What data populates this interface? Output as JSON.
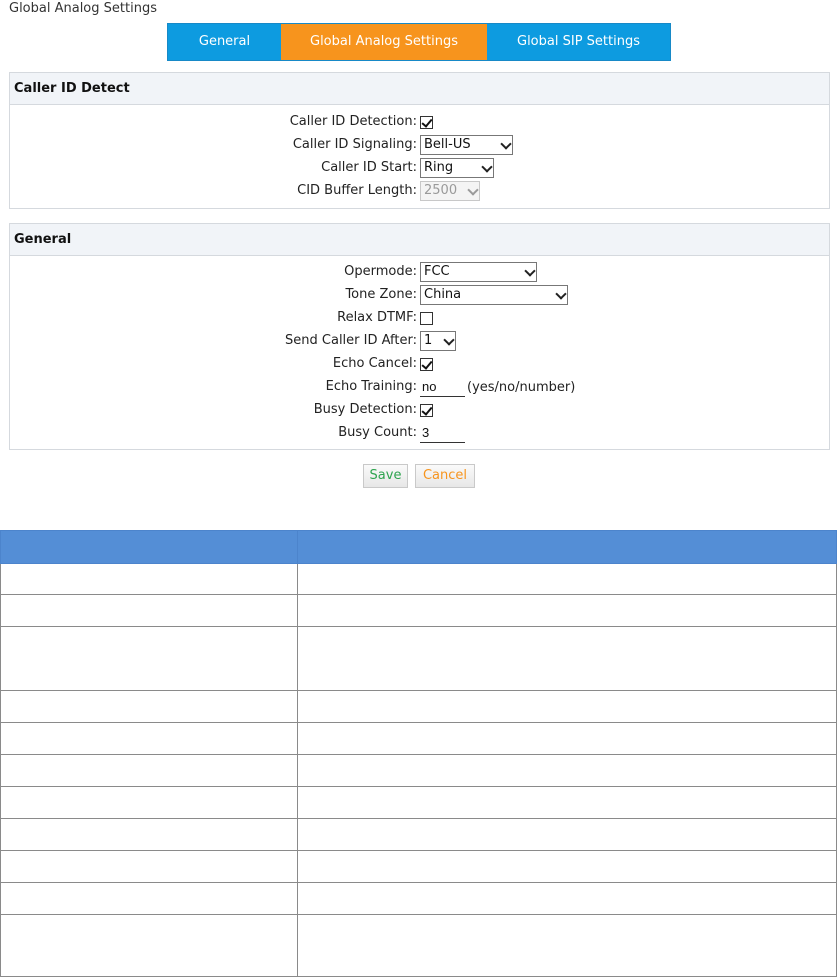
{
  "page_title": "Global Analog Settings",
  "tabs": [
    {
      "label": "General"
    },
    {
      "label": "Global Analog Settings"
    },
    {
      "label": "Global SIP Settings"
    }
  ],
  "caller_id_detect": {
    "title": "Caller ID Detect",
    "caller_id_detection": {
      "label": "Caller ID Detection:",
      "checked": true
    },
    "caller_id_signaling": {
      "label": "Caller ID Signaling:",
      "value": "Bell-US"
    },
    "caller_id_start": {
      "label": "Caller ID Start:",
      "value": "Ring"
    },
    "cid_buffer_length": {
      "label": "CID Buffer Length:",
      "value": "2500",
      "disabled": true
    }
  },
  "general": {
    "title": "General",
    "opermode": {
      "label": "Opermode:",
      "value": "FCC"
    },
    "tone_zone": {
      "label": "Tone Zone:",
      "value": "China"
    },
    "relax_dtmf": {
      "label": "Relax DTMF:",
      "checked": false
    },
    "send_caller_id_after": {
      "label": "Send Caller ID After:",
      "value": "1"
    },
    "echo_cancel": {
      "label": "Echo Cancel:",
      "checked": true
    },
    "echo_training": {
      "label": "Echo Training:",
      "value": "no",
      "hint": "(yes/no/number)"
    },
    "busy_detection": {
      "label": "Busy Detection:",
      "checked": true
    },
    "busy_count": {
      "label": "Busy Count:",
      "value": "3"
    }
  },
  "actions": {
    "save_label": "Save",
    "cancel_label": "Cancel"
  },
  "colors": {
    "tab_blue": "#0d9be0",
    "tab_active": "#f7941d",
    "table_header": "#548ed6",
    "save_text": "#2ea44f",
    "cancel_text": "#f7941d"
  }
}
